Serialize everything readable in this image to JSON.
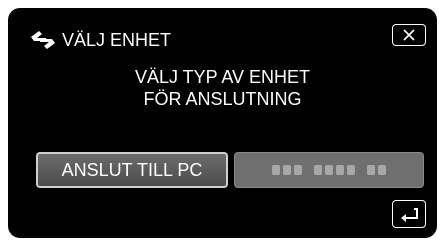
{
  "header": {
    "title": "VÄLJ ENHET",
    "icon": "device-connect-icon",
    "close_icon": "close-icon"
  },
  "message": {
    "line1": "VÄLJ TYP AV ENHET",
    "line2": "FÖR ANSLUTNING"
  },
  "buttons": {
    "connect_pc_label": "ANSLUT TILL PC",
    "second_option_icon": "blurred-label",
    "back_icon": "return-arrow-icon"
  },
  "colors": {
    "screen_bg": "#000000",
    "text": "#ffffff",
    "button_bg": "#5a5a5a",
    "disabled_bg": "#6f6f6f"
  }
}
